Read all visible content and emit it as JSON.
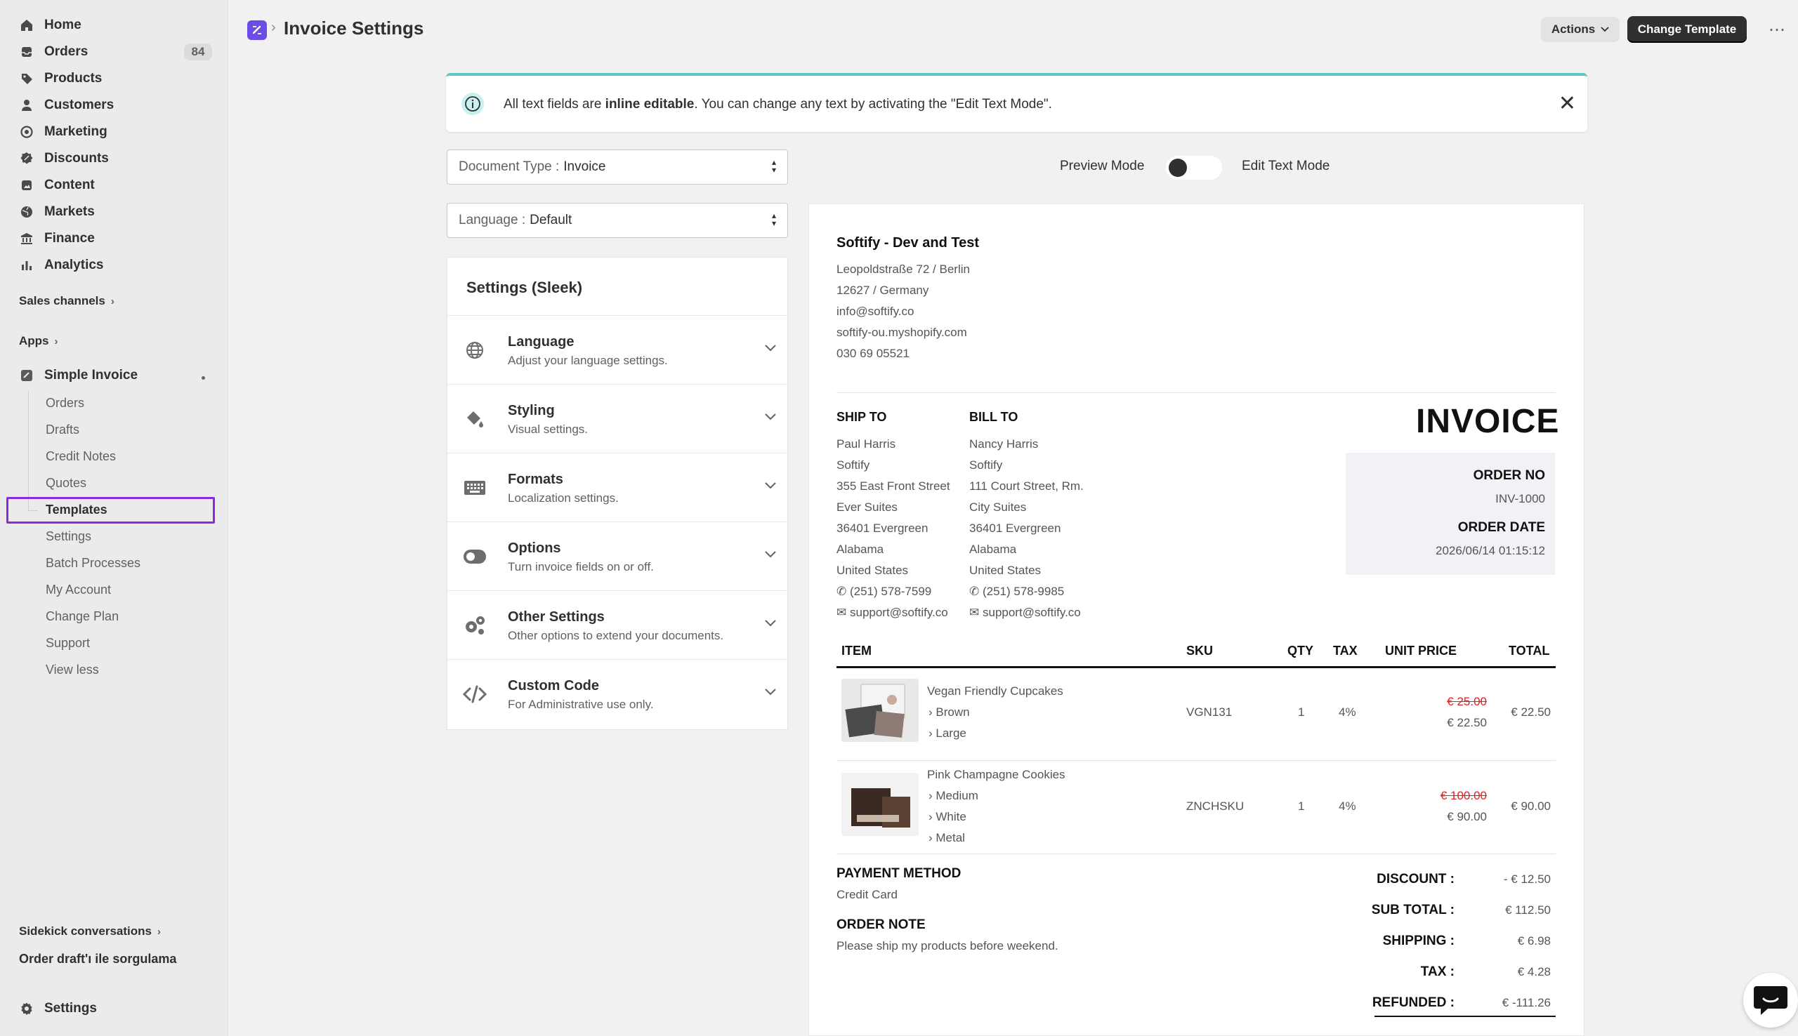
{
  "sidebar": {
    "items": [
      {
        "label": "Home",
        "icon": "home-icon"
      },
      {
        "label": "Orders",
        "icon": "orders-icon"
      },
      {
        "label": "Products",
        "icon": "tag-icon"
      },
      {
        "label": "Customers",
        "icon": "person-icon"
      },
      {
        "label": "Marketing",
        "icon": "target-icon"
      },
      {
        "label": "Discounts",
        "icon": "discount-icon"
      },
      {
        "label": "Content",
        "icon": "content-icon"
      },
      {
        "label": "Markets",
        "icon": "globe-icon"
      },
      {
        "label": "Finance",
        "icon": "bank-icon"
      },
      {
        "label": "Analytics",
        "icon": "bar-chart-icon"
      }
    ],
    "orders_count": "84",
    "sales_channels": "Sales channels",
    "apps": "Apps",
    "app_name": "Simple Invoice",
    "app_sub": [
      "Orders",
      "Drafts",
      "Credit Notes",
      "Quotes",
      "Templates",
      "Settings",
      "Batch Processes",
      "My Account",
      "Change Plan",
      "Support",
      "View less"
    ],
    "sidekick": "Sidekick conversations",
    "conversation": "Order draft'ı ile sorgulama",
    "settings": "Settings"
  },
  "header": {
    "title": "Invoice Settings",
    "actions": "Actions",
    "change_template": "Change Template",
    "more": "⋯"
  },
  "banner": {
    "pre": "All text fields are ",
    "bold": "inline editable",
    "post": ". You can change any text by activating the \"Edit Text Mode\"."
  },
  "controls": {
    "doc_type_label": "Document Type :",
    "doc_type_value": "Invoice",
    "language_label": "Language :",
    "language_value": "Default",
    "preview_mode": "Preview Mode",
    "edit_mode": "Edit Text Mode"
  },
  "settings_panel": {
    "title": "Settings (Sleek)",
    "rows": [
      {
        "title": "Language",
        "sub": "Adjust your language settings."
      },
      {
        "title": "Styling",
        "sub": "Visual settings."
      },
      {
        "title": "Formats",
        "sub": "Localization settings."
      },
      {
        "title": "Options",
        "sub": "Turn invoice fields on or off."
      },
      {
        "title": "Other Settings",
        "sub": "Other options to extend your documents."
      },
      {
        "title": "Custom Code",
        "sub": "For Administrative use only."
      }
    ]
  },
  "invoice": {
    "shop_name": "Softify - Dev and Test",
    "shop_lines": [
      "Leopoldstraße 72 / Berlin",
      "12627 / Germany",
      "info@softify.co",
      "softify-ou.myshopify.com",
      "030 69 05521"
    ],
    "ship_to": {
      "heading": "SHIP TO",
      "lines": [
        "Paul Harris",
        "Softify",
        "355 East Front Street",
        "Ever Suites",
        "36401 Evergreen",
        "Alabama",
        "United States"
      ],
      "phone": "(251) 578-7599",
      "email": "support@softify.co"
    },
    "bill_to": {
      "heading": "BILL TO",
      "lines": [
        "Nancy Harris",
        "Softify",
        "111 Court Street, Rm.",
        "City Suites",
        "36401 Evergreen",
        "Alabama",
        "United States"
      ],
      "phone": "(251) 578-9985",
      "email": "support@softify.co"
    },
    "title": "INVOICE",
    "order_no_label": "ORDER NO",
    "order_no": "INV-1000",
    "order_date_label": "ORDER DATE",
    "order_date": "2026/06/14 01:15:12",
    "columns": {
      "item": "ITEM",
      "sku": "SKU",
      "qty": "QTY",
      "tax": "TAX",
      "unit_price": "UNIT PRICE",
      "total": "TOTAL"
    },
    "items": [
      {
        "name": "Vegan Friendly Cupcakes",
        "variants": [
          "Brown",
          "Large"
        ],
        "sku": "VGN131",
        "qty": "1",
        "tax": "4%",
        "old_price": "€ 25.00",
        "price": "€ 22.50",
        "total": "€ 22.50"
      },
      {
        "name": "Pink Champagne Cookies",
        "variants": [
          "Medium",
          "White",
          "Metal"
        ],
        "sku": "ZNCHSKU",
        "qty": "1",
        "tax": "4%",
        "old_price": "€ 100.00",
        "price": "€ 90.00",
        "total": "€ 90.00"
      }
    ],
    "payment_method_label": "PAYMENT METHOD",
    "payment_method": "Credit Card",
    "order_note_label": "ORDER NOTE",
    "order_note": "Please ship my products before weekend.",
    "totals": [
      {
        "label": "DISCOUNT :",
        "value": "- € 12.50"
      },
      {
        "label": "SUB TOTAL :",
        "value": "€ 112.50"
      },
      {
        "label": "SHIPPING :",
        "value": "€ 6.98"
      },
      {
        "label": "TAX :",
        "value": "€ 4.28"
      },
      {
        "label": "REFUNDED :",
        "value": "€ -111.26"
      }
    ]
  },
  "colors": {
    "accent": "#8a2be2",
    "brand": "#6b4de6",
    "banner": "#5fc6c6",
    "strike": "#e02020"
  }
}
